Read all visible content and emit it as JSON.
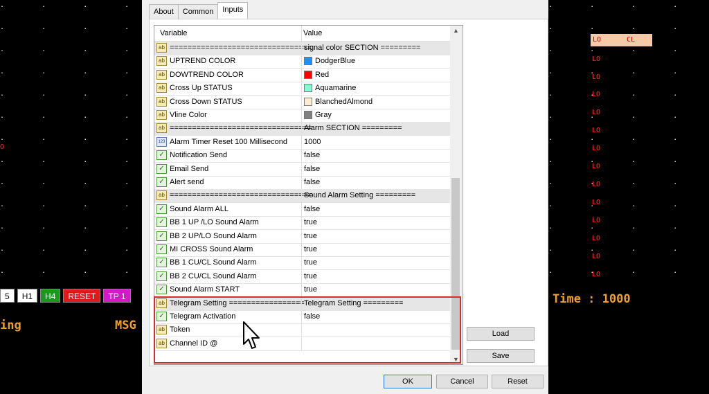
{
  "background": {
    "toolbar_buttons": [
      {
        "label": "5",
        "bg": "#ffffff",
        "fg": "#000000"
      },
      {
        "label": "H1",
        "bg": "#ffffff",
        "fg": "#000000"
      },
      {
        "label": "H4",
        "bg": "#1a9a1a",
        "fg": "#ffffff"
      },
      {
        "label": "RESET",
        "bg": "#e01a1a",
        "fg": "#ffffff"
      },
      {
        "label": "TP 1",
        "bg": "#d41ac8",
        "fg": "#ffffff"
      }
    ],
    "left_text": "ing",
    "msg_text": "MSG",
    "time_text": "Time : 1000",
    "lo_label": "LO",
    "cl_label": "CL",
    "left_o": "O"
  },
  "dialog": {
    "tabs": [
      {
        "label": "About",
        "active": false
      },
      {
        "label": "Common",
        "active": false
      },
      {
        "label": "Inputs",
        "active": true
      }
    ],
    "columns": {
      "variable": "Variable",
      "value": "Value"
    },
    "rows": [
      {
        "icon": "ab",
        "name": "================================",
        "value": "signal color SECTION =========",
        "section": true
      },
      {
        "icon": "ab",
        "name": "UPTREND COLOR",
        "value": "DodgerBlue",
        "swatch": "#1e90ff"
      },
      {
        "icon": "ab",
        "name": "DOWTREND COLOR",
        "value": "Red",
        "swatch": "#ff0000"
      },
      {
        "icon": "ab",
        "name": "Cross Up STATUS",
        "value": "Aquamarine",
        "swatch": "#7fffd4"
      },
      {
        "icon": "ab",
        "name": "Cross Down STATUS",
        "value": "BlanchedAlmond",
        "swatch": "#ffebcd"
      },
      {
        "icon": "ab",
        "name": "Vline Color",
        "value": "Gray",
        "swatch": "#808080"
      },
      {
        "icon": "ab",
        "name": "================================",
        "value": "Alarm  SECTION =========",
        "section": true
      },
      {
        "icon": "123",
        "name": "Alarm Timer Reset 100 Millisecond",
        "value": "1000"
      },
      {
        "icon": "bool",
        "name": "Notification Send",
        "value": "false"
      },
      {
        "icon": "bool",
        "name": "Email Send",
        "value": "false"
      },
      {
        "icon": "bool",
        "name": "Alert send",
        "value": "false"
      },
      {
        "icon": "ab",
        "name": "================================",
        "value": "Sound Alarm Setting =========",
        "section": true
      },
      {
        "icon": "bool",
        "name": "Sound Alarm ALL",
        "value": "false"
      },
      {
        "icon": "bool",
        "name": "BB 1  UP /LO Sound Alarm",
        "value": "true"
      },
      {
        "icon": "bool",
        "name": "BB 2 UP/LO Sound Alarm",
        "value": "true"
      },
      {
        "icon": "bool",
        "name": "MI CROSS  Sound Alarm",
        "value": "true"
      },
      {
        "icon": "bool",
        "name": "BB 1 CU/CL  Sound Alarm",
        "value": "true"
      },
      {
        "icon": "bool",
        "name": "BB 2  CU/CL  Sound Alarm",
        "value": "true"
      },
      {
        "icon": "bool",
        "name": "Sound Alarm START",
        "value": "true"
      },
      {
        "icon": "ab",
        "name": "Telegram Setting =================",
        "value": "Telegram Setting =========",
        "section": true
      },
      {
        "icon": "bool",
        "name": "Telegram Activation",
        "value": "false"
      },
      {
        "icon": "ab",
        "name": "Token",
        "value": ""
      },
      {
        "icon": "ab",
        "name": "Channel ID @",
        "value": ""
      }
    ],
    "side_buttons": {
      "load": "Load",
      "save": "Save"
    },
    "footer_buttons": {
      "ok": "OK",
      "cancel": "Cancel",
      "reset": "Reset"
    }
  }
}
